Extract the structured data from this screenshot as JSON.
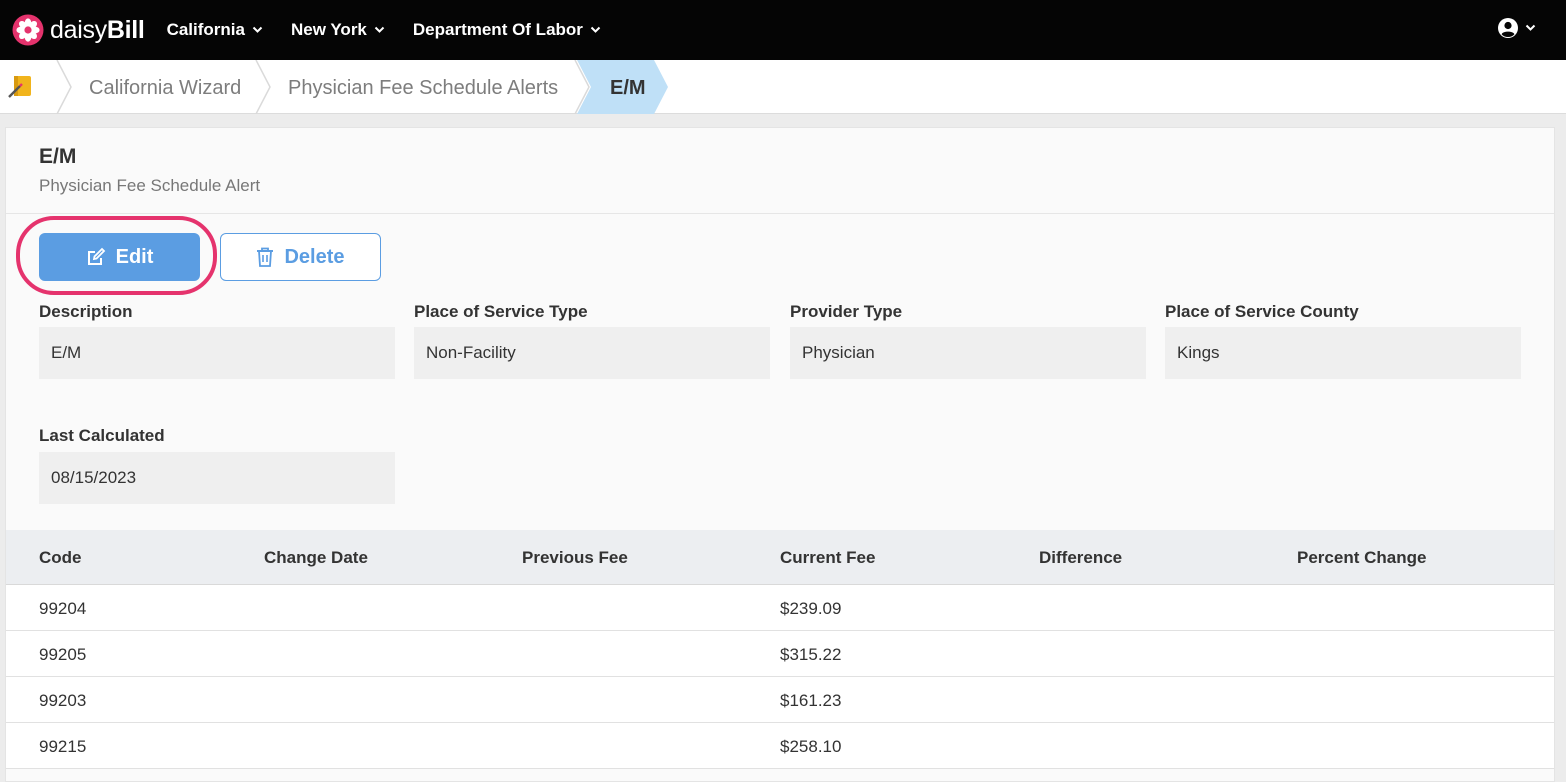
{
  "navbar": {
    "brand_part1": "daisy",
    "brand_part2": "Bill",
    "menu": [
      {
        "label": "California"
      },
      {
        "label": "New York"
      },
      {
        "label": "Department Of Labor"
      }
    ],
    "user_icon": "user-circle-icon"
  },
  "breadcrumb": {
    "home_icon": "notebook-pencil-icon",
    "items": [
      {
        "label": "California Wizard"
      },
      {
        "label": "Physician Fee Schedule Alerts"
      },
      {
        "label": "E/M",
        "active": true
      }
    ],
    "active_color": "#bfe0f7"
  },
  "panel": {
    "title": "E/M",
    "subtitle": "Physician Fee Schedule Alert"
  },
  "actions": {
    "edit_label": "Edit",
    "delete_label": "Delete",
    "edit_icon": "edit-icon",
    "delete_icon": "trash-icon",
    "accent_color": "#5b9de2",
    "highlight_color": "#e5336d"
  },
  "fields": {
    "description": {
      "label": "Description",
      "value": "E/M"
    },
    "pos_type": {
      "label": "Place of Service Type",
      "value": "Non-Facility"
    },
    "provider_type": {
      "label": "Provider Type",
      "value": "Physician"
    },
    "pos_county": {
      "label": "Place of Service County",
      "value": "Kings"
    },
    "last_calculated": {
      "label": "Last Calculated",
      "value": "08/15/2023"
    }
  },
  "table": {
    "headers": [
      "Code",
      "Change Date",
      "Previous Fee",
      "Current Fee",
      "Difference",
      "Percent Change"
    ],
    "rows": [
      {
        "code": "99204",
        "change_date": "",
        "previous_fee": "",
        "current_fee": "$239.09",
        "difference": "",
        "percent_change": ""
      },
      {
        "code": "99205",
        "change_date": "",
        "previous_fee": "",
        "current_fee": "$315.22",
        "difference": "",
        "percent_change": ""
      },
      {
        "code": "99203",
        "change_date": "",
        "previous_fee": "",
        "current_fee": "$161.23",
        "difference": "",
        "percent_change": ""
      },
      {
        "code": "99215",
        "change_date": "",
        "previous_fee": "",
        "current_fee": "$258.10",
        "difference": "",
        "percent_change": ""
      }
    ]
  }
}
